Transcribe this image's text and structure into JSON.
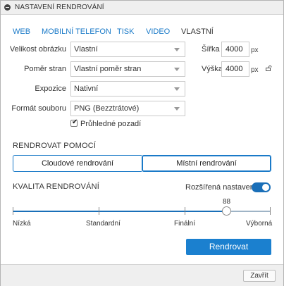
{
  "window": {
    "title": "NASTAVENÍ RENDROVÁNÍ"
  },
  "tabs": [
    {
      "label": "WEB",
      "active": false
    },
    {
      "label": "MOBILNÍ TELEFON",
      "active": false
    },
    {
      "label": "TISK",
      "active": false
    },
    {
      "label": "VIDEO",
      "active": false
    },
    {
      "label": "VLASTNÍ",
      "active": true
    }
  ],
  "form": {
    "image_size": {
      "label": "Velikost obrázku",
      "value": "Vlastní"
    },
    "aspect": {
      "label": "Poměr stran",
      "value": "Vlastní poměr stran"
    },
    "exposure": {
      "label": "Expozice",
      "value": "Nativní"
    },
    "file_format": {
      "label": "Formát souboru",
      "value": "PNG (Bezztrátové)"
    },
    "width": {
      "label": "Šířka",
      "value": "4000",
      "unit": "px"
    },
    "height": {
      "label": "Výška",
      "value": "4000",
      "unit": "px"
    },
    "transparent_bg": {
      "label": "Průhledné pozadí",
      "checked": true
    }
  },
  "render_with": {
    "heading": "RENDROVAT POMOCÍ",
    "options": [
      "Cloudové rendrování",
      "Místní rendrování"
    ],
    "selected": "Místní rendrování"
  },
  "quality": {
    "heading": "KVALITA RENDROVÁNÍ",
    "advanced_label": "Rozšířená nastavení",
    "advanced_on": true,
    "value": "88",
    "level_fraction": 0.83,
    "marks": [
      "Nízká",
      "Standardní",
      "Finální",
      "Výborná"
    ]
  },
  "buttons": {
    "render": "Rendrovat",
    "close": "Zavřít"
  },
  "colors": {
    "accent": "#1b80cf",
    "link": "#1a7ac8",
    "toggle": "#1a6fb8"
  }
}
